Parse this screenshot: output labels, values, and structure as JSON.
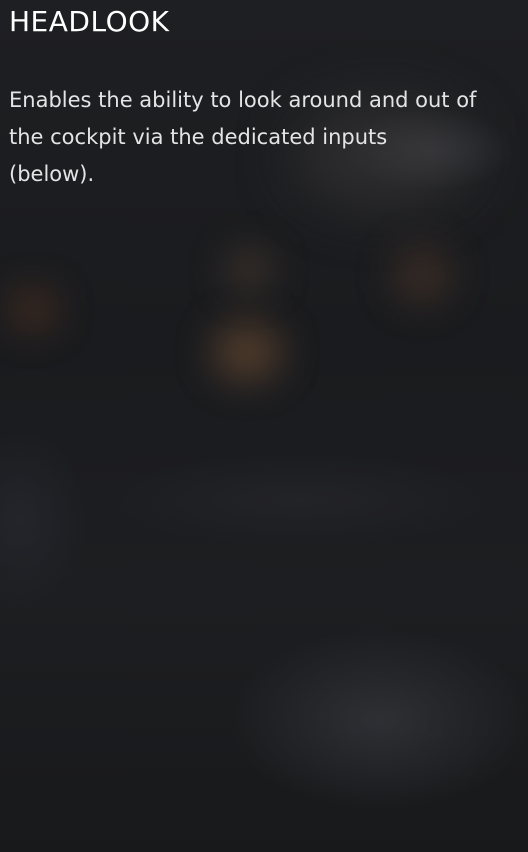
{
  "panel": {
    "title": "HEADLOOK",
    "description": "Enables the ability to look around and out of the cockpit via the dedicated inputs (below)."
  },
  "colors": {
    "title": "#ffffff",
    "description": "#e4e4e6",
    "background": "#1c1d20"
  }
}
